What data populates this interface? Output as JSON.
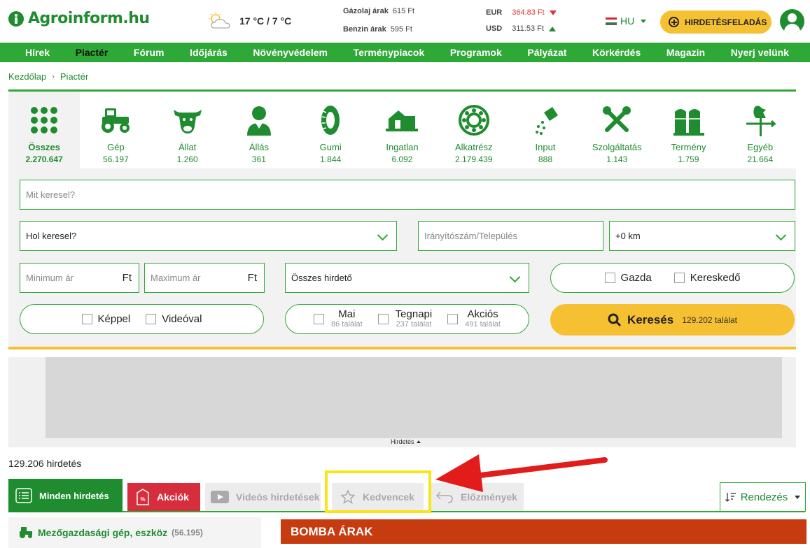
{
  "header": {
    "logo": "Agroinform.hu",
    "weather": "17 °C / 7 °C",
    "fuel": [
      {
        "label": "Gázolaj árak",
        "value": "615 Ft"
      },
      {
        "label": "Benzin árak",
        "value": "595 Ft"
      }
    ],
    "fx": [
      {
        "label": "EUR",
        "value": "364.83 Ft",
        "trend": "down"
      },
      {
        "label": "USD",
        "value": "311.53 Ft",
        "trend": "up"
      }
    ],
    "lang": "HU",
    "post_button": "HIRDETÉSFELADÁS"
  },
  "nav": [
    "Hírek",
    "Piactér",
    "Fórum",
    "Időjárás",
    "Növényvédelem",
    "Terménypiacok",
    "Programok",
    "Pályázat",
    "Körkérdés",
    "Magazin",
    "Nyerj velünk"
  ],
  "breadcrumb": [
    "Kezdőlap",
    "Piactér"
  ],
  "categories": [
    {
      "label": "Összes",
      "count": "2.270.647",
      "icon": "grid-icon"
    },
    {
      "label": "Gép",
      "count": "56.197",
      "icon": "tractor-icon"
    },
    {
      "label": "Állat",
      "count": "1.260",
      "icon": "cow-icon"
    },
    {
      "label": "Állás",
      "count": "361",
      "icon": "person-icon"
    },
    {
      "label": "Gumi",
      "count": "1.844",
      "icon": "tire-icon"
    },
    {
      "label": "Ingatlan",
      "count": "6.092",
      "icon": "farmhouse-icon"
    },
    {
      "label": "Alkatrész",
      "count": "2.179.439",
      "icon": "bearing-icon"
    },
    {
      "label": "Input",
      "count": "888",
      "icon": "seed-bag-icon"
    },
    {
      "label": "Szolgáltatás",
      "count": "1.143",
      "icon": "tools-icon"
    },
    {
      "label": "Termény",
      "count": "1.759",
      "icon": "silo-icon"
    },
    {
      "label": "Egyéb",
      "count": "21.664",
      "icon": "weathervane-icon"
    }
  ],
  "search": {
    "what_placeholder": "Mit keresel?",
    "where_value": "Hol keresel?",
    "zip_placeholder": "Irányítószám/Település",
    "radius": "+0 km",
    "min_price": "Minimum ár",
    "max_price": "Maximum ár",
    "currency": "Ft",
    "advertiser": "Összes hirdető",
    "gazda": "Gazda",
    "kereskedo": "Kereskedő",
    "with_photo": "Képpel",
    "with_video": "Videóval",
    "today": "Mai",
    "today_count": "86 találat",
    "yesterday": "Tegnapi",
    "yesterday_count": "237 találat",
    "sale": "Akciós",
    "sale_count": "491 találat",
    "button": "Keresés",
    "button_count": "129.202 találat"
  },
  "ad_label": "Hirdetés",
  "total": "129.206 hirdetés",
  "tabs": {
    "all": "Minden hirdetés",
    "sale": "Akciók",
    "video": "Videós hirdetések",
    "favorites": "Kedvencek",
    "history": "Előzmények",
    "sort": "Rendezés"
  },
  "left_category": {
    "label": "Mezőgazdasági gép, eszköz",
    "count": "(56.195)"
  },
  "bomba": "BOMBA ÁRAK",
  "colors": {
    "green": "#2ea836",
    "dark_green": "#1e8c2f",
    "yellow": "#f6c033",
    "red": "#d72e3d",
    "highlight": "#f7e51a"
  }
}
